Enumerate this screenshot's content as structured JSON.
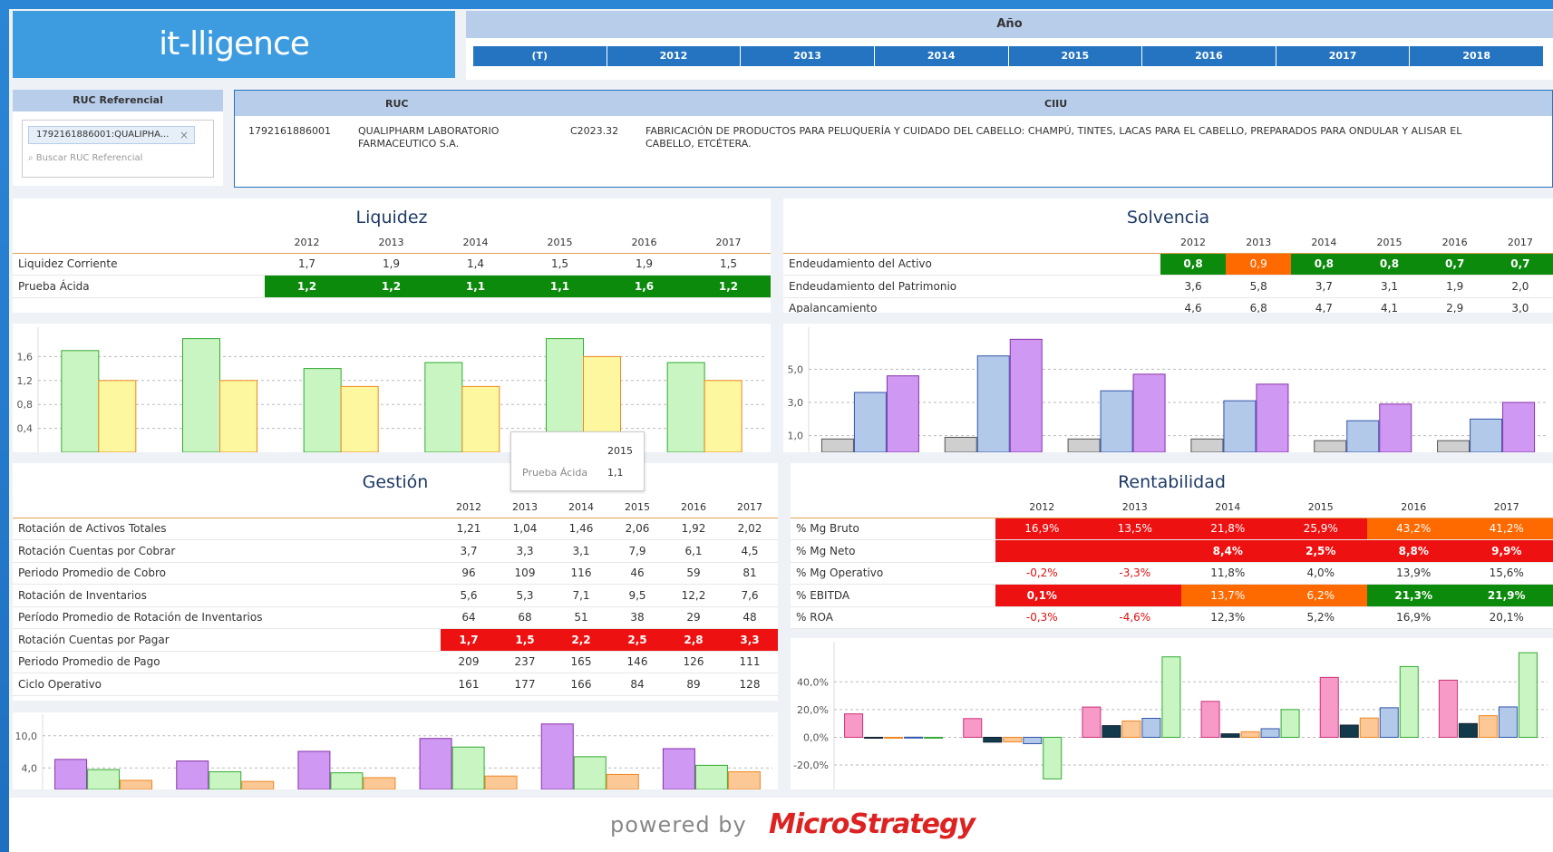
{
  "app": {
    "logo": "it-lligence"
  },
  "year": {
    "title": "Año",
    "tabs": [
      "(T)",
      "2012",
      "2013",
      "2014",
      "2015",
      "2016",
      "2017",
      "2018"
    ]
  },
  "ruc_ref": {
    "title": "RUC Referencial",
    "chip": "1792161886001:QUALIPHA...",
    "search_placeholder": "Buscar RUC Referencial"
  },
  "ruc_table": {
    "col_ruc": "RUC",
    "col_ciiu": "CIIU",
    "ruc": "1792161886001",
    "name_line1": "QUALIPHARM LABORATORIO",
    "name_line2": "FARMACEUTICO S.A.",
    "ciiu_code": "C2023.32",
    "ciiu_line1": "FABRICACIÓN DE PRODUCTOS PARA PELUQUERÍA Y CUIDADO DEL CABELLO: CHAMPÚ, TINTES, LACAS PARA EL CABELLO, PREPARADOS PARA ONDULAR Y ALISAR EL",
    "ciiu_line2": "CABELLO, ETCÉTERA."
  },
  "years": [
    "2012",
    "2013",
    "2014",
    "2015",
    "2016",
    "2017"
  ],
  "liquidez": {
    "title": "Liquidez",
    "rows": [
      {
        "label": "Liquidez Corriente",
        "values": [
          "1,7",
          "1,9",
          "1,4",
          "1,5",
          "1,9",
          "1,5"
        ]
      },
      {
        "label": "Prueba Ácida",
        "values": [
          "1,2",
          "1,2",
          "1,1",
          "1,1",
          "1,6",
          "1,2"
        ]
      }
    ]
  },
  "solvencia": {
    "title": "Solvencia",
    "rows": [
      {
        "label": "Endeudamiento del Activo",
        "values": [
          "0,8",
          "0,9",
          "0,8",
          "0,8",
          "0,7",
          "0,7"
        ]
      },
      {
        "label": "Endeudamiento del Patrimonio",
        "values": [
          "3,6",
          "5,8",
          "3,7",
          "3,1",
          "1,9",
          "2,0"
        ]
      },
      {
        "label": "Apalancamiento",
        "values": [
          "4,6",
          "6,8",
          "4,7",
          "4,1",
          "2,9",
          "3,0"
        ]
      }
    ]
  },
  "gestion": {
    "title": "Gestión",
    "rows": [
      {
        "label": "Rotación de Activos Totales",
        "values": [
          "1,21",
          "1,04",
          "1,46",
          "2,06",
          "1,92",
          "2,02"
        ]
      },
      {
        "label": "Rotación Cuentas por Cobrar",
        "values": [
          "3,7",
          "3,3",
          "3,1",
          "7,9",
          "6,1",
          "4,5"
        ]
      },
      {
        "label": "Periodo Promedio de Cobro",
        "values": [
          "96",
          "109",
          "116",
          "46",
          "59",
          "81"
        ]
      },
      {
        "label": "Rotación de Inventarios",
        "values": [
          "5,6",
          "5,3",
          "7,1",
          "9,5",
          "12,2",
          "7,6"
        ]
      },
      {
        "label": "Período Promedio de Rotación de Inventarios",
        "values": [
          "64",
          "68",
          "51",
          "38",
          "29",
          "48"
        ]
      },
      {
        "label": "Rotación Cuentas por Pagar",
        "values": [
          "1,7",
          "1,5",
          "2,2",
          "2,5",
          "2,8",
          "3,3"
        ]
      },
      {
        "label": "Periodo Promedio de Pago",
        "values": [
          "209",
          "237",
          "165",
          "146",
          "126",
          "111"
        ]
      },
      {
        "label": "Ciclo Operativo",
        "values": [
          "161",
          "177",
          "166",
          "84",
          "89",
          "128"
        ]
      }
    ]
  },
  "rentabilidad": {
    "title": "Rentabilidad",
    "rows": [
      {
        "label": "% Mg Bruto",
        "values": [
          "16,9%",
          "13,5%",
          "21,8%",
          "25,9%",
          "43,2%",
          "41,2%"
        ]
      },
      {
        "label": "% Mg Neto",
        "values": [
          "",
          "",
          "8,4%",
          "2,5%",
          "8,8%",
          "9,9%"
        ]
      },
      {
        "label": "% Mg Operativo",
        "values": [
          "-0,2%",
          "-3,3%",
          "11,8%",
          "4,0%",
          "13,9%",
          "15,6%"
        ]
      },
      {
        "label": "% EBITDA",
        "values": [
          "0,1%",
          "",
          "13,7%",
          "6,2%",
          "21,3%",
          "21,9%"
        ]
      },
      {
        "label": "% ROA",
        "values": [
          "-0,3%",
          "-4,6%",
          "12,3%",
          "5,2%",
          "16,9%",
          "20,1%"
        ]
      }
    ]
  },
  "tooltip": {
    "year": "2015",
    "label": "Prueba Ácida",
    "value": "1,1"
  },
  "footer": {
    "powered": "powered by",
    "brand": "MicroStrategy"
  },
  "chart_data": [
    {
      "type": "bar",
      "categories": [
        "2012",
        "2013",
        "2014",
        "2015",
        "2016",
        "2017"
      ],
      "series": [
        {
          "name": "Liquidez Corriente",
          "values": [
            1.7,
            1.9,
            1.4,
            1.5,
            1.9,
            1.5
          ],
          "color": "#c9f5c2"
        },
        {
          "name": "Prueba Ácida",
          "values": [
            1.2,
            1.2,
            1.1,
            1.1,
            1.6,
            1.2
          ],
          "color": "#fdf7a0"
        }
      ],
      "yticks": [
        "0,4",
        "0,8",
        "1,2",
        "1,6"
      ],
      "ylim": [
        0,
        2.0
      ]
    },
    {
      "type": "bar",
      "categories": [
        "2012",
        "2013",
        "2014",
        "2015",
        "2016",
        "2017"
      ],
      "series": [
        {
          "name": "Endeudamiento del Activo",
          "values": [
            0.8,
            0.9,
            0.8,
            0.8,
            0.7,
            0.7
          ],
          "color": "#cfcfcf"
        },
        {
          "name": "Endeudamiento del Patrimonio",
          "values": [
            3.6,
            5.8,
            3.7,
            3.1,
            1.9,
            2.0
          ],
          "color": "#b3c9ea"
        },
        {
          "name": "Apalancamiento",
          "values": [
            4.6,
            6.8,
            4.7,
            4.1,
            2.9,
            3.0
          ],
          "color": "#cf98f2"
        }
      ],
      "yticks": [
        "1,0",
        "3,0",
        "5,0"
      ],
      "ylim": [
        0,
        7.2
      ]
    },
    {
      "type": "bar",
      "categories": [
        "2012",
        "2013",
        "2014",
        "2015",
        "2016",
        "2017"
      ],
      "series": [
        {
          "name": "Rotación de Inventarios",
          "values": [
            5.6,
            5.3,
            7.1,
            9.5,
            12.2,
            7.6
          ],
          "color": "#cf98f2"
        },
        {
          "name": "Rotación Cuentas por Cobrar",
          "values": [
            3.7,
            3.3,
            3.1,
            7.9,
            6.1,
            4.5
          ],
          "color": "#c9f5c2"
        },
        {
          "name": "Rotación Cuentas por Pagar",
          "values": [
            1.7,
            1.5,
            2.2,
            2.5,
            2.8,
            3.3
          ],
          "color": "#fcc895"
        }
      ],
      "yticks": [
        "4,0",
        "10,0"
      ],
      "ylim": [
        0,
        13
      ]
    },
    {
      "type": "bar",
      "categories": [
        "2012",
        "2013",
        "2014",
        "2015",
        "2016",
        "2017"
      ],
      "series": [
        {
          "name": "% Mg Bruto",
          "values": [
            16.9,
            13.5,
            21.8,
            25.9,
            43.2,
            41.2
          ],
          "color": "#f79ac8"
        },
        {
          "name": "% Mg Neto",
          "values": [
            -0.5,
            -3.5,
            8.4,
            2.5,
            8.8,
            9.9
          ],
          "color": "#123a4a"
        },
        {
          "name": "% Mg Operativo",
          "values": [
            -0.2,
            -3.3,
            11.8,
            4.0,
            13.9,
            15.6
          ],
          "color": "#fcc895"
        },
        {
          "name": "% EBITDA",
          "values": [
            0.1,
            -4.6,
            13.7,
            6.2,
            21.3,
            21.9
          ],
          "color": "#b3c9ea"
        },
        {
          "name": "% ROA",
          "values": [
            -0.3,
            -30.0,
            58.0,
            20.0,
            51.0,
            61.0
          ],
          "color": "#c9f5c2"
        }
      ],
      "yticks": [
        "-20,0%",
        "0,0%",
        "20,0%",
        "40,0%"
      ],
      "ylim": [
        -35,
        65
      ]
    }
  ]
}
